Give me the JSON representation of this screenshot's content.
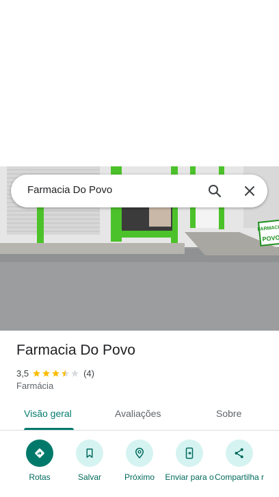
{
  "search": {
    "query": "Farmacia Do Povo"
  },
  "place": {
    "name": "Farmacia Do Povo",
    "rating": "3,5",
    "rating_value": 3.5,
    "review_count": "(4)",
    "category": "Farmácia",
    "photo_sign_text": "FARMACIA DO POVO"
  },
  "tabs": [
    {
      "label": "Visão geral",
      "active": true
    },
    {
      "label": "Avaliações",
      "active": false
    },
    {
      "label": "Sobre",
      "active": false
    }
  ],
  "actions": [
    {
      "label": "Rotas",
      "icon": "directions-icon"
    },
    {
      "label": "Salvar",
      "icon": "bookmark-icon"
    },
    {
      "label": "Próximo",
      "icon": "nearby-icon"
    },
    {
      "label": "Enviar para o",
      "icon": "send-to-phone-icon"
    },
    {
      "label": "Compartilha r",
      "icon": "share-icon"
    }
  ],
  "colors": {
    "accent": "#00796b",
    "action_bg": "#d5f3f1",
    "star": "#fbbc04",
    "star_empty": "#dadce0"
  }
}
